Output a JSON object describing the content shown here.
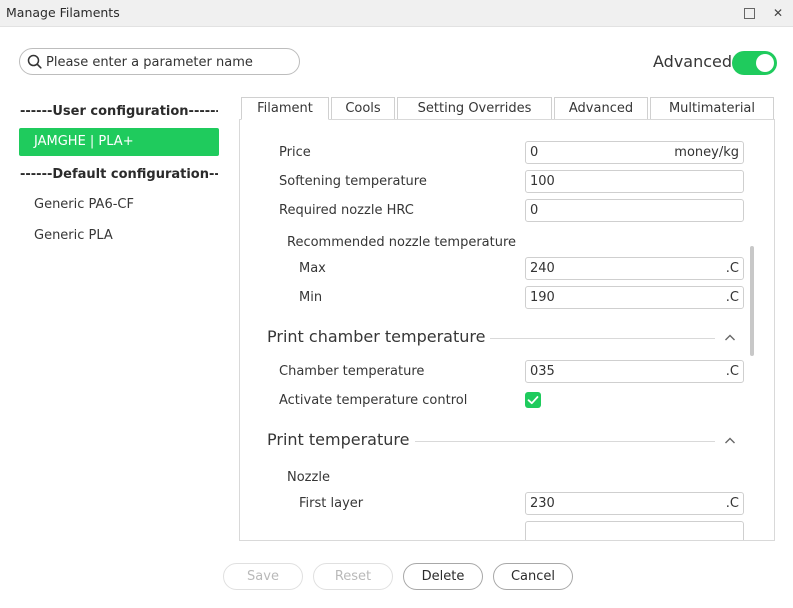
{
  "window": {
    "title": "Manage Filaments",
    "maximize_icon": "maximize-icon",
    "close_glyph": "✕"
  },
  "search": {
    "placeholder": "Please enter a parameter name",
    "value": ""
  },
  "advanced_toggle": {
    "label": "Advanced",
    "on": true,
    "color": "#1fcb5d"
  },
  "sidebar": {
    "user_group": "------User configuration------",
    "user_items": [
      {
        "label": "JAMGHE | PLA+",
        "selected": true
      }
    ],
    "default_group": "------Default configuration------",
    "default_items": [
      {
        "label": "Generic PA6-CF"
      },
      {
        "label": "Generic PLA"
      }
    ]
  },
  "tabs": [
    {
      "label": "Filament",
      "active": true
    },
    {
      "label": "Cools"
    },
    {
      "label": "Setting Overrides"
    },
    {
      "label": "Advanced"
    },
    {
      "label": "Multimaterial"
    }
  ],
  "filament": {
    "price": {
      "label": "Price",
      "value": "0",
      "unit": "money/kg"
    },
    "softening": {
      "label": "Softening temperature",
      "value": "100"
    },
    "nozzle_hrc": {
      "label": "Required nozzle HRC",
      "value": "0"
    },
    "recommended": {
      "label": "Recommended nozzle temperature",
      "max": {
        "label": "Max",
        "value": "240",
        "unit": ".C"
      },
      "min": {
        "label": "Min",
        "value": "190",
        "unit": ".C"
      }
    },
    "chamber_section": {
      "title": "Print chamber temperature",
      "chamber_temp": {
        "label": "Chamber temperature",
        "value": "035",
        "unit": ".C"
      },
      "activate_control": {
        "label": "Activate temperature control",
        "checked": true
      }
    },
    "print_temp_section": {
      "title": "Print temperature",
      "nozzle_label": "Nozzle",
      "first_layer": {
        "label": "First layer",
        "value": "230",
        "unit": ".C"
      }
    }
  },
  "buttons": {
    "save": "Save",
    "reset": "Reset",
    "delete": "Delete",
    "cancel": "Cancel"
  }
}
